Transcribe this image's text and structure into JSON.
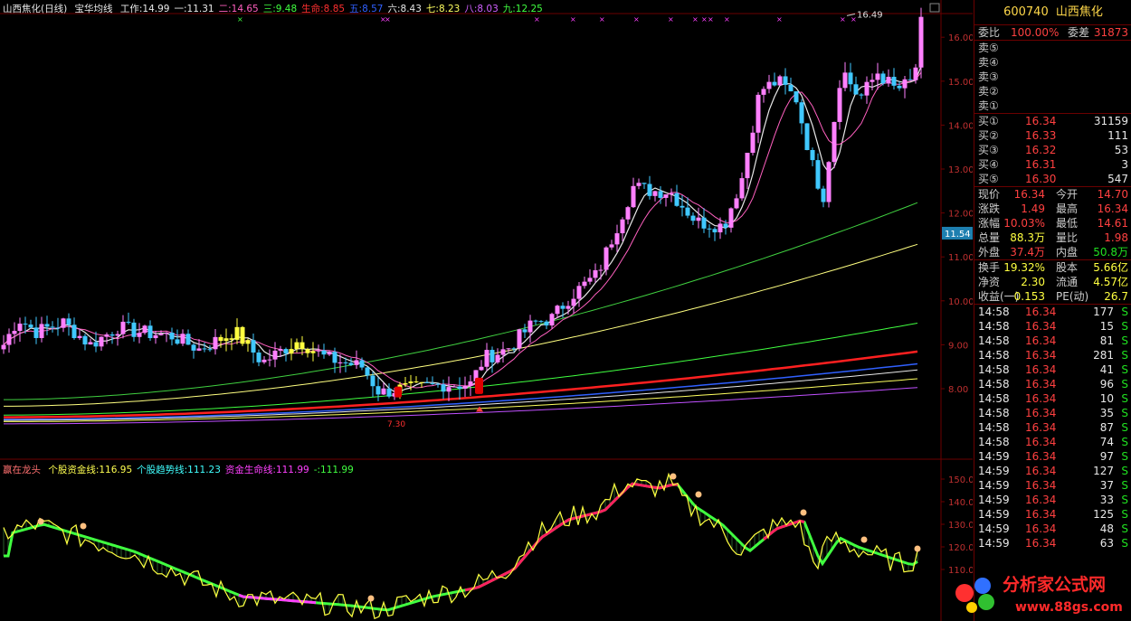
{
  "legend_main": {
    "title": "山西焦化(日线)",
    "indicator": "宝华均线",
    "items": [
      {
        "label": "工作:14.99",
        "color": "#e8e8e8"
      },
      {
        "label": "一:11.31",
        "color": "#e8e8e8"
      },
      {
        "label": "二:14.65",
        "color": "#ff5fbf"
      },
      {
        "label": "三:9.48",
        "color": "#40ff40"
      },
      {
        "label": "生命:8.85",
        "color": "#ff3030"
      },
      {
        "label": "五:8.57",
        "color": "#3060ff"
      },
      {
        "label": "六:8.43",
        "color": "#e8e8e8"
      },
      {
        "label": "七:8.23",
        "color": "#ffff60"
      },
      {
        "label": "八:8.03",
        "color": "#d060ff"
      },
      {
        "label": "九:12.25",
        "color": "#40ff40"
      }
    ]
  },
  "legend_sub": {
    "title": "赢在龙头",
    "items": [
      {
        "label": "个股资金线:116.95",
        "color": "#ffff50"
      },
      {
        "label": "个股趋势线:111.23",
        "color": "#40ffff"
      },
      {
        "label": "资金生命线:111.99",
        "color": "#ff40ff"
      },
      {
        "label": "-:111.99",
        "color": "#40ff40"
      }
    ]
  },
  "axis": {
    "main_ticks": [
      "16.00",
      "15.00",
      "14.00",
      "13.00",
      "12.00",
      "11.00",
      "10.00",
      "9.00",
      "8.00"
    ],
    "sub_ticks": [
      "150.0",
      "140.0",
      "130.0",
      "120.0",
      "110.0"
    ],
    "current_marker": "11.54",
    "high_label": "16.49",
    "low_label": "7.30"
  },
  "quote": {
    "code": "600740",
    "name": "山西焦化",
    "weibi": {
      "label": "委比",
      "value": "100.00%",
      "label2": "委差",
      "value2": "31873"
    },
    "sells": [
      {
        "label": "卖⑤"
      },
      {
        "label": "卖④"
      },
      {
        "label": "卖③"
      },
      {
        "label": "卖②"
      },
      {
        "label": "卖①"
      }
    ],
    "buys": [
      {
        "label": "买①",
        "price": "16.34",
        "vol": "31159"
      },
      {
        "label": "买②",
        "price": "16.33",
        "vol": "111"
      },
      {
        "label": "买③",
        "price": "16.32",
        "vol": "53"
      },
      {
        "label": "买④",
        "price": "16.31",
        "vol": "3"
      },
      {
        "label": "买⑤",
        "price": "16.30",
        "vol": "547"
      }
    ],
    "stats": [
      {
        "l1": "现价",
        "v1": "16.34",
        "c1": "red",
        "l2": "今开",
        "v2": "14.70",
        "c2": "red"
      },
      {
        "l1": "涨跌",
        "v1": "1.49",
        "c1": "red",
        "l2": "最高",
        "v2": "16.34",
        "c2": "red"
      },
      {
        "l1": "涨幅",
        "v1": "10.03%",
        "c1": "red",
        "l2": "最低",
        "v2": "14.61",
        "c2": "red"
      },
      {
        "l1": "总量",
        "v1": "88.3万",
        "c1": "ylw",
        "l2": "量比",
        "v2": "1.98",
        "c2": "red"
      },
      {
        "l1": "外盘",
        "v1": "37.4万",
        "c1": "red",
        "l2": "内盘",
        "v2": "50.8万",
        "c2": "grn"
      }
    ],
    "fund": [
      {
        "l1": "换手",
        "v1": "19.32%",
        "l2": "股本",
        "v2": "5.66亿"
      },
      {
        "l1": "净资",
        "v1": "2.30",
        "l2": "流通",
        "v2": "4.57亿"
      },
      {
        "l1": "收益(一)",
        "v1": "0.153",
        "l2": "PE(动)",
        "v2": "26.7"
      }
    ],
    "ticks": [
      {
        "time": "14:58",
        "price": "16.34",
        "vol": "177",
        "side": "S"
      },
      {
        "time": "14:58",
        "price": "16.34",
        "vol": "15",
        "side": "S"
      },
      {
        "time": "14:58",
        "price": "16.34",
        "vol": "81",
        "side": "S"
      },
      {
        "time": "14:58",
        "price": "16.34",
        "vol": "281",
        "side": "S"
      },
      {
        "time": "14:58",
        "price": "16.34",
        "vol": "41",
        "side": "S"
      },
      {
        "time": "14:58",
        "price": "16.34",
        "vol": "96",
        "side": "S"
      },
      {
        "time": "14:58",
        "price": "16.34",
        "vol": "10",
        "side": "S"
      },
      {
        "time": "14:58",
        "price": "16.34",
        "vol": "35",
        "side": "S"
      },
      {
        "time": "14:58",
        "price": "16.34",
        "vol": "87",
        "side": "S"
      },
      {
        "time": "14:58",
        "price": "16.34",
        "vol": "74",
        "side": "S"
      },
      {
        "time": "14:59",
        "price": "16.34",
        "vol": "97",
        "side": "S"
      },
      {
        "time": "14:59",
        "price": "16.34",
        "vol": "127",
        "side": "S"
      },
      {
        "time": "14:59",
        "price": "16.34",
        "vol": "37",
        "side": "S"
      },
      {
        "time": "14:59",
        "price": "16.34",
        "vol": "33",
        "side": "S"
      },
      {
        "time": "14:59",
        "price": "16.34",
        "vol": "125",
        "side": "S"
      },
      {
        "time": "14:59",
        "price": "16.34",
        "vol": "48",
        "side": "S"
      },
      {
        "time": "14:59",
        "price": "16.34",
        "vol": "63",
        "side": "S"
      }
    ]
  },
  "watermark": {
    "text": "分析家公式网",
    "url": "www.88gs.com"
  },
  "colors": {
    "up_candle": "#ff80ff",
    "down_candle": "#40c8ff",
    "yellow_candle": "#ffff40",
    "grid": "#6b0000"
  }
}
